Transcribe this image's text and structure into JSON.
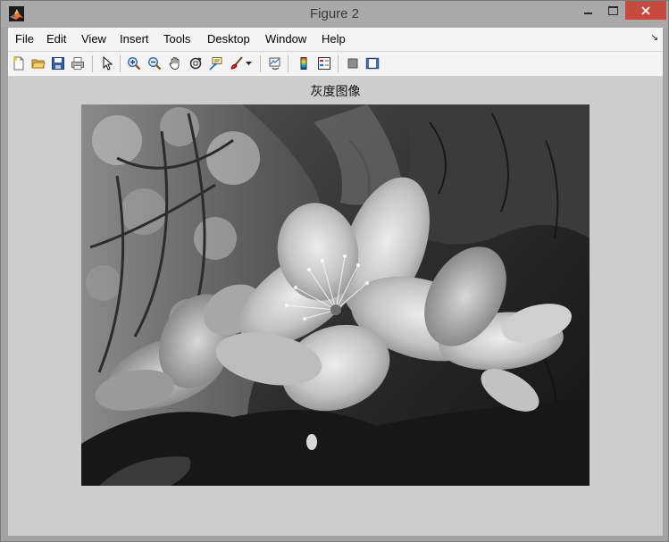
{
  "window": {
    "title": "Figure 2",
    "icon": "matlab-icon"
  },
  "menu": {
    "items": [
      {
        "label": "File"
      },
      {
        "label": "Edit"
      },
      {
        "label": "View"
      },
      {
        "label": "Insert"
      },
      {
        "label": "Tools"
      },
      {
        "label": "Desktop"
      },
      {
        "label": "Window"
      },
      {
        "label": "Help"
      }
    ],
    "overflow_icon": "dock-arrow-icon"
  },
  "toolbar": {
    "buttons": [
      {
        "icon": "new-figure-icon"
      },
      {
        "icon": "open-file-icon"
      },
      {
        "icon": "save-figure-icon"
      },
      {
        "icon": "print-figure-icon"
      },
      {
        "icon": "edit-plot-arrow-icon"
      },
      {
        "icon": "zoom-in-icon"
      },
      {
        "icon": "zoom-out-icon"
      },
      {
        "icon": "pan-hand-icon"
      },
      {
        "icon": "rotate-3d-icon"
      },
      {
        "icon": "data-cursor-icon"
      },
      {
        "icon": "brush-icon"
      },
      {
        "icon": "link-plot-icon"
      },
      {
        "icon": "insert-colorbar-icon"
      },
      {
        "icon": "insert-legend-icon"
      },
      {
        "icon": "hide-plot-tools-icon"
      },
      {
        "icon": "show-plot-tools-icon"
      }
    ]
  },
  "axes": {
    "title": "灰度图像"
  },
  "image": {
    "description_icon": "grayscale-flower-image",
    "colors": {
      "dark": "#151515",
      "mid": "#6a6a6a",
      "light": "#e6e6e6"
    }
  }
}
